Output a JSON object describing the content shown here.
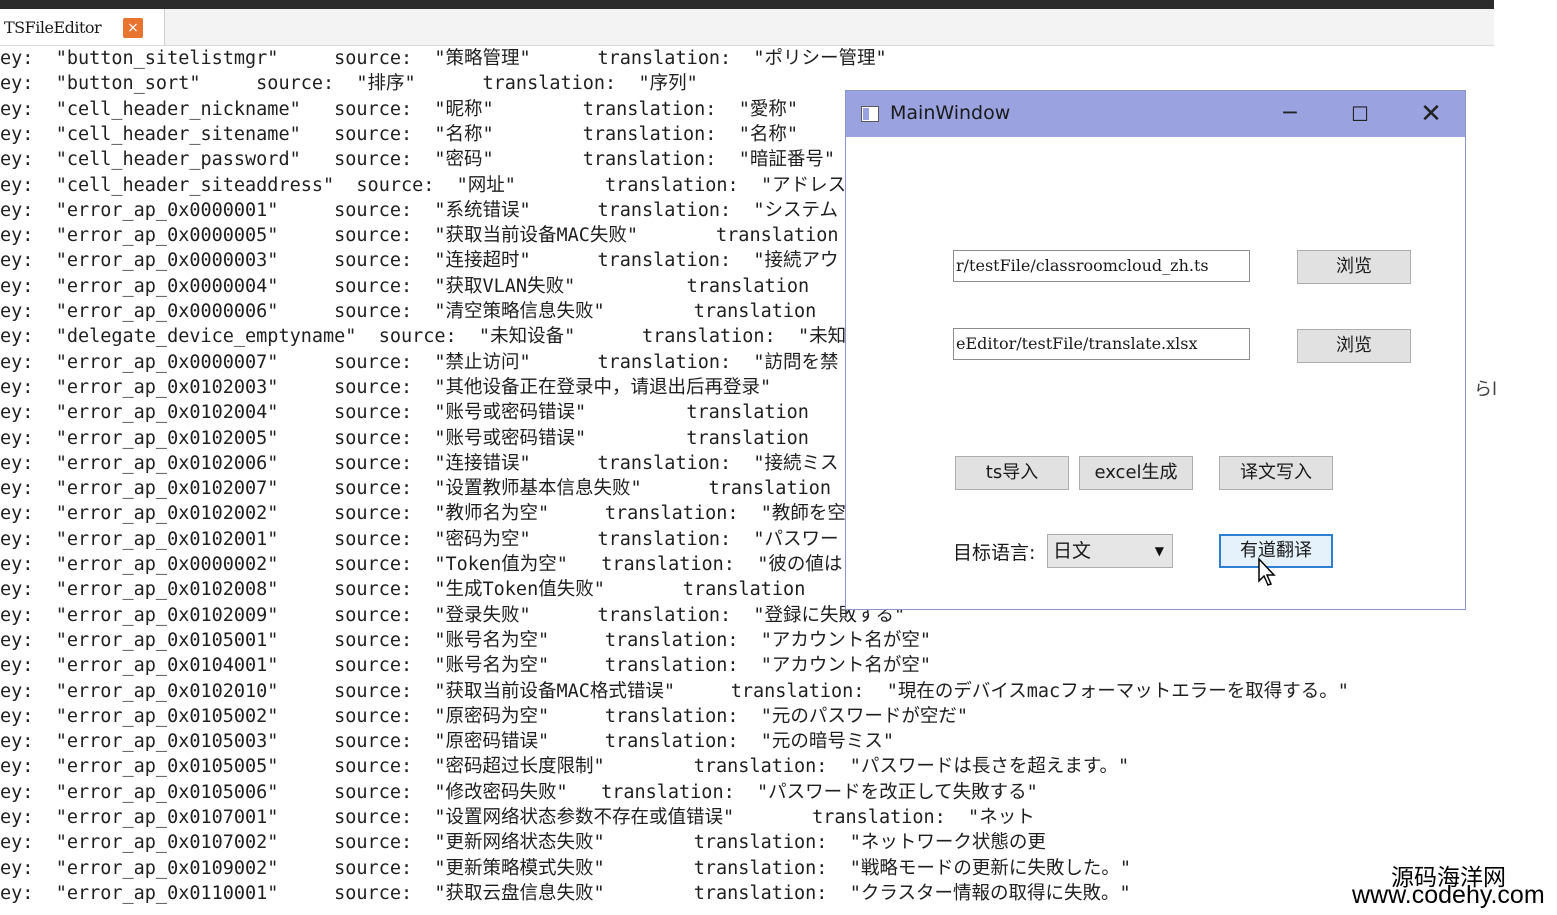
{
  "editor": {
    "tab_title": "TSFileEditor",
    "tab_close_glyph": "×",
    "lines": [
      "ey:  \"button_sitelistmgr\"     source:  \"策略管理\"      translation:  \"ポリシー管理\"",
      "ey:  \"button_sort\"     source:  \"排序\"      translation:  \"序列\"",
      "ey:  \"cell_header_nickname\"   source:  \"昵称\"        translation:  \"愛称\"",
      "ey:  \"cell_header_sitename\"   source:  \"名称\"        translation:  \"名称\"",
      "ey:  \"cell_header_password\"   source:  \"密码\"        translation:  \"暗証番号\"",
      "ey:  \"cell_header_siteaddress\"  source:  \"网址\"        translation:  \"アドレス\"",
      "ey:  \"error_ap_0x0000001\"     source:  \"系统错误\"      translation:  \"システム",
      "ey:  \"error_ap_0x0000005\"     source:  \"获取当前设备MAC失败\"       translation",
      "ey:  \"error_ap_0x0000003\"     source:  \"连接超时\"      translation:  \"接続アウ",
      "ey:  \"error_ap_0x0000004\"     source:  \"获取VLAN失败\"          translation",
      "ey:  \"error_ap_0x0000006\"     source:  \"清空策略信息失败\"        translation",
      "ey:  \"delegate_device_emptyname\"  source:  \"未知设备\"      translation:  \"未知の設",
      "ey:  \"error_ap_0x0000007\"     source:  \"禁止访问\"      translation:  \"訪問を禁",
      "ey:  \"error_ap_0x0102003\"     source:  \"其他设备正在登录中，请退出后再登录\"",
      "ey:  \"error_ap_0x0102004\"     source:  \"账号或密码错误\"         translation",
      "ey:  \"error_ap_0x0102005\"     source:  \"账号或密码错误\"         translation",
      "ey:  \"error_ap_0x0102006\"     source:  \"连接错误\"      translation:  \"接続ミス",
      "ey:  \"error_ap_0x0102007\"     source:  \"设置教师基本信息失败\"      translation",
      "ey:  \"error_ap_0x0102002\"     source:  \"教师名为空\"     translation:  \"教師を空",
      "ey:  \"error_ap_0x0102001\"     source:  \"密码为空\"      translation:  \"パスワー",
      "ey:  \"error_ap_0x0000002\"     source:  \"Token值为空\"   translation:  \"彼の値は",
      "ey:  \"error_ap_0x0102008\"     source:  \"生成Token值失败\"       translation",
      "ey:  \"error_ap_0x0102009\"     source:  \"登录失败\"      translation:  \"登録に失敗する\"",
      "ey:  \"error_ap_0x0105001\"     source:  \"账号名为空\"     translation:  \"アカウント名が空\"",
      "ey:  \"error_ap_0x0104001\"     source:  \"账号名为空\"     translation:  \"アカウント名が空\"",
      "ey:  \"error_ap_0x0102010\"     source:  \"获取当前设备MAC格式错误\"     translation:  \"現在のデバイスmacフォーマットエラーを取得する。\"",
      "ey:  \"error_ap_0x0105002\"     source:  \"原密码为空\"     translation:  \"元のパスワードが空だ\"",
      "ey:  \"error_ap_0x0105003\"     source:  \"原密码错误\"     translation:  \"元の暗号ミス\"",
      "ey:  \"error_ap_0x0105005\"     source:  \"密码超过长度限制\"        translation:  \"パスワードは長さを超えます。\"",
      "ey:  \"error_ap_0x0105006\"     source:  \"修改密码失败\"   translation:  \"パスワードを改正して失敗する\"",
      "ey:  \"error_ap_0x0107001\"     source:  \"设置网络状态参数不存在或值错误\"       translation:  \"ネット",
      "ey:  \"error_ap_0x0107002\"     source:  \"更新网络状态失败\"        translation:  \"ネットワーク状態の更",
      "ey:  \"error_ap_0x0109002\"     source:  \"更新策略模式失败\"        translation:  \"戦略モードの更新に失敗した。\"",
      "ey:  \"error_ap_0x0110001\"     source:  \"获取云盘信息失败\"        translation:  \"クラスター情報の取得に失敗。\""
    ],
    "stray_text": "らl"
  },
  "window": {
    "title": "MainWindow",
    "minimize_glyph": "─",
    "maximize_glyph": "☐",
    "close_glyph": "✕",
    "ts_path": "r/testFile/classroomcloud_zh.ts",
    "xlsx_path": "eEditor/testFile/translate.xlsx",
    "browse_label_1": "浏览",
    "browse_label_2": "浏览",
    "ts_import_label": "ts导入",
    "excel_generate_label": "excel生成",
    "write_translation_label": "译文写入",
    "target_language_label": "目标语言:",
    "target_language_value": "日文",
    "youdao_translate_label": "有道翻译"
  },
  "watermark": {
    "line1": "源码海洋网",
    "line2": "www.codehy.com"
  }
}
